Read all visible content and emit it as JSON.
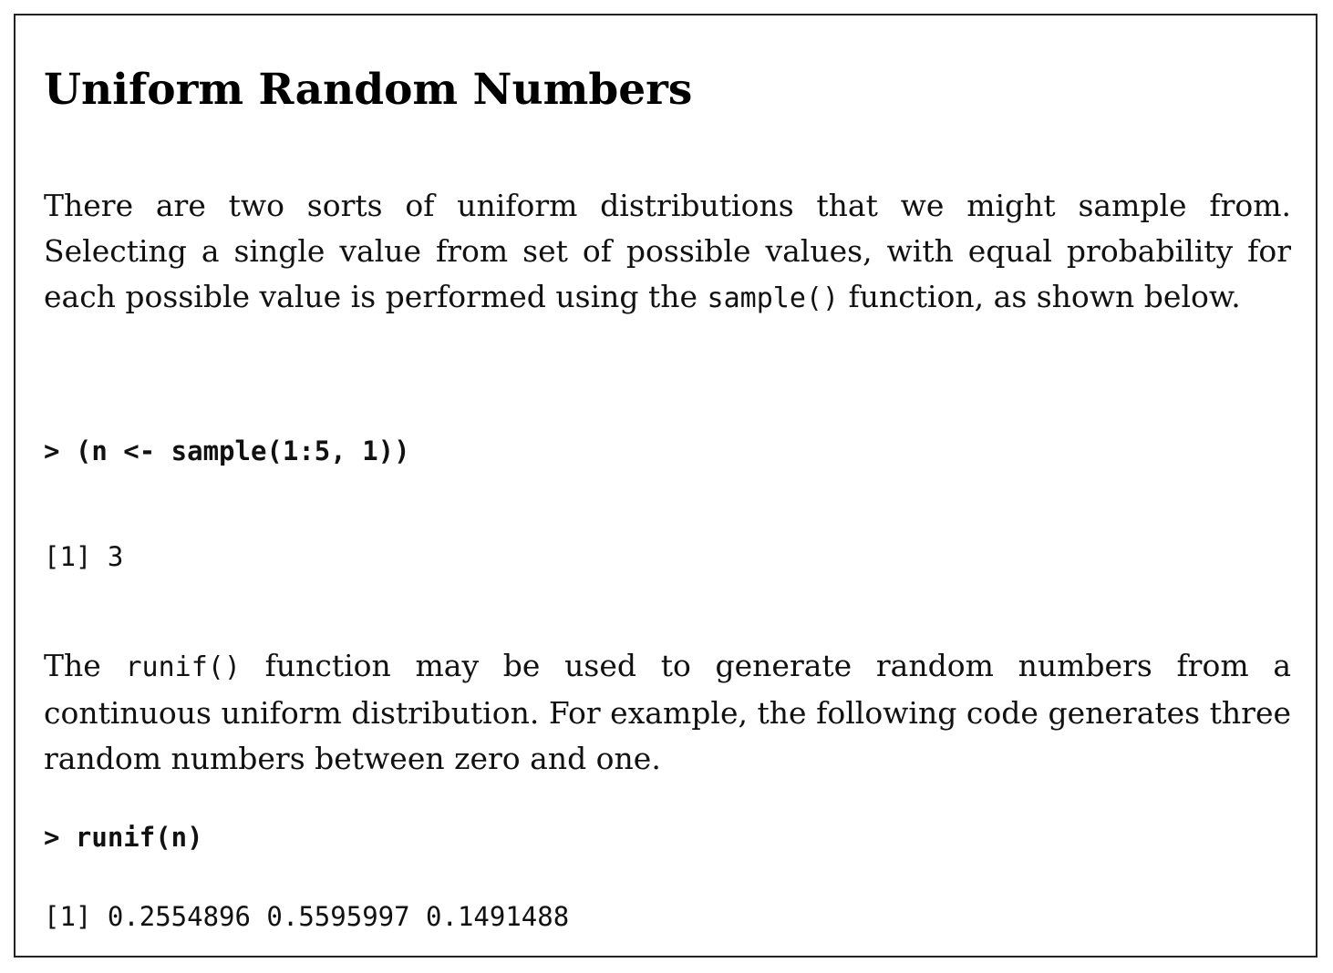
{
  "title": "Uniform Random Numbers",
  "paragraph1": {
    "before": "There are two sorts of uniform distributions that we might sample from. Selecting a single value from set of possible values, with equal probability for each possible value is performed using the ",
    "code": "sample()",
    "after": " function, as shown below."
  },
  "code_block1": {
    "input": "> (n <- sample(1:5, 1))",
    "output": "[1] 3"
  },
  "paragraph2": {
    "before": "The ",
    "code": "runif()",
    "after": " function may be used to generate random numbers from a continuous uniform distribution. For example, the following code generates three random numbers between zero and one."
  },
  "code_block2": {
    "input": "> runif(n)",
    "output": "[1] 0.2554896 0.5595997 0.1491488"
  }
}
